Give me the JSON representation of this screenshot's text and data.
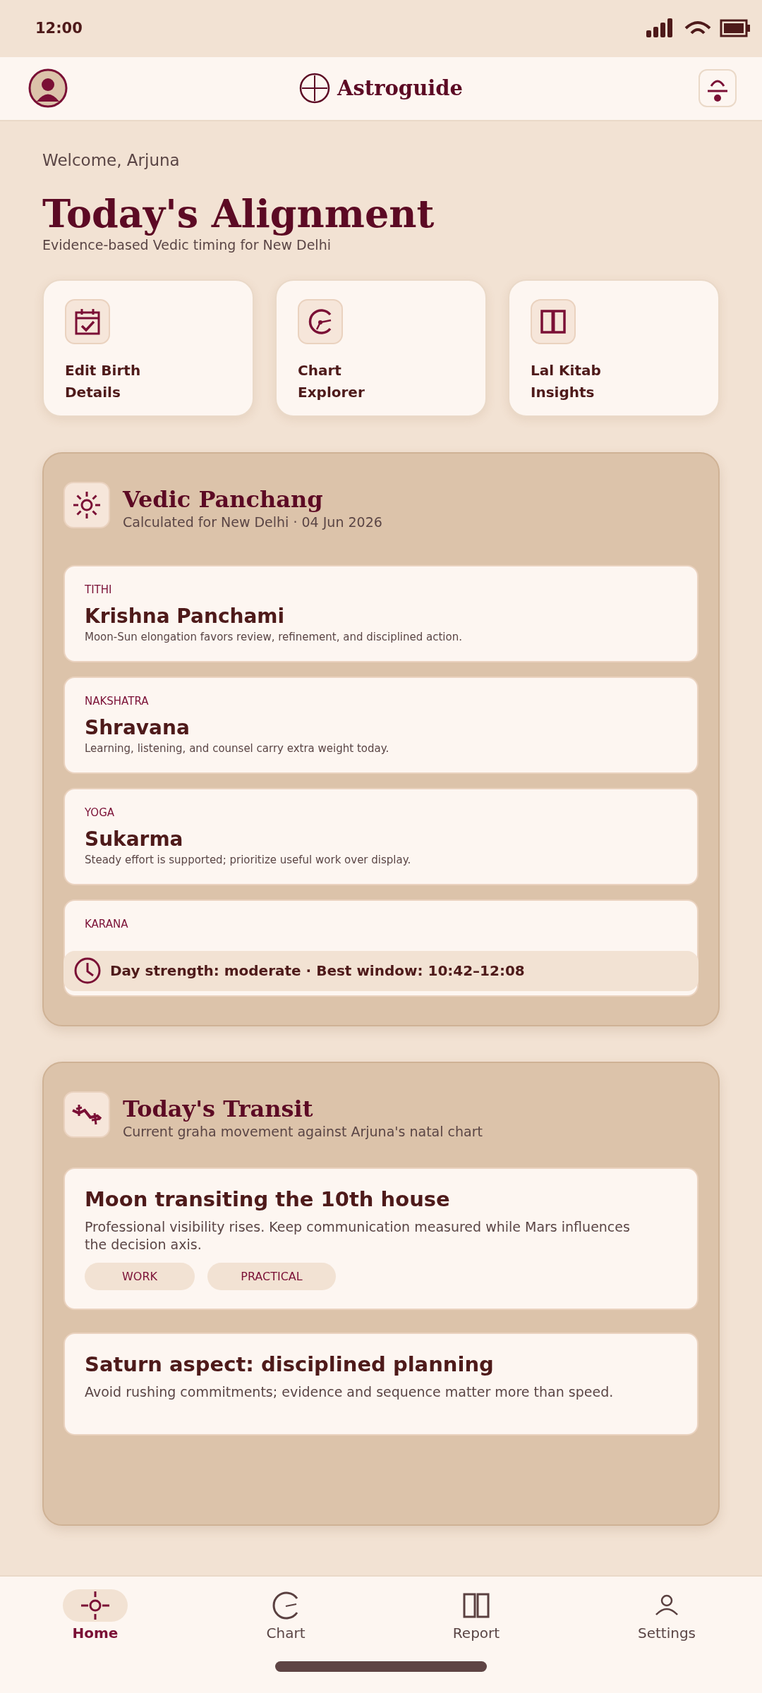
{
  "status_bar": {
    "time": "12:00"
  },
  "app_bar": {
    "title": "Astroguide"
  },
  "greeting": "Welcome, Arjuna",
  "heading": "Today's Alignment",
  "subheading": "Evidence-based Vedic timing for New Delhi",
  "quick_actions": [
    {
      "kind": "calendar",
      "label": "Edit Birth Details"
    },
    {
      "kind": "dial",
      "label": "Chart Explorer"
    },
    {
      "kind": "book",
      "label": "Lal Kitab Insights"
    }
  ],
  "panchang": {
    "title": "Vedic Panchang",
    "subtitle": "Calculated for New Delhi · 04 Jun 2026",
    "items": [
      {
        "label": "TITHI",
        "value": "Krishna Panchami",
        "note": "Moon-Sun elongation favors review, refinement, and disciplined action."
      },
      {
        "label": "NAKSHATRA",
        "value": "Shravana",
        "note": "Learning, listening, and counsel carry extra weight today."
      },
      {
        "label": "YOGA",
        "value": "Sukarma",
        "note": "Steady effort is supported; prioritize useful work over display."
      },
      {
        "label": "KARANA"
      }
    ],
    "summary": "Day strength: moderate · Best window: 10:42–12:08"
  },
  "transit": {
    "title": "Today's Transit",
    "subtitle": "Current graha movement against Arjuna's natal chart",
    "items": [
      {
        "title": "Moon transiting the 10th house",
        "body": "Professional visibility rises. Keep communication measured while Mars influences the decision axis.",
        "tags": [
          "WORK",
          "PRACTICAL"
        ]
      },
      {
        "title": "Saturn aspect: disciplined planning",
        "body": "Avoid rushing commitments; evidence and sequence matter more than speed."
      }
    ]
  },
  "nav": [
    {
      "kind": "home",
      "label": "Home",
      "selected": true
    },
    {
      "kind": "chart",
      "label": "Chart",
      "selected": false
    },
    {
      "kind": "report",
      "label": "Report",
      "selected": false
    },
    {
      "kind": "settings",
      "label": "Settings",
      "selected": false
    }
  ]
}
